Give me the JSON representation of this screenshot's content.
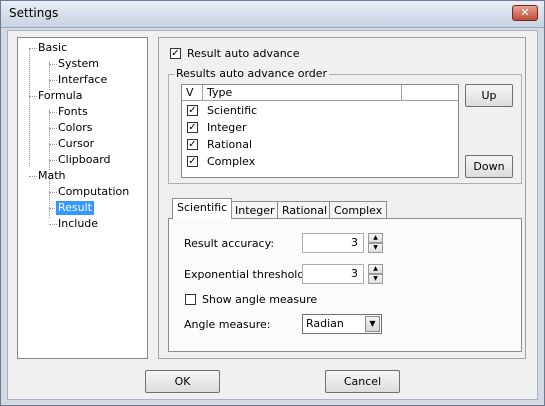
{
  "window": {
    "title": "Settings",
    "close_glyph": "✕"
  },
  "tree": {
    "items": [
      {
        "label": "Basic",
        "level": 0
      },
      {
        "label": "System",
        "level": 1
      },
      {
        "label": "Interface",
        "level": 1
      },
      {
        "label": "Formula",
        "level": 0
      },
      {
        "label": "Fonts",
        "level": 1
      },
      {
        "label": "Colors",
        "level": 1
      },
      {
        "label": "Cursor",
        "level": 1
      },
      {
        "label": "Clipboard",
        "level": 1
      },
      {
        "label": "Math",
        "level": 0
      },
      {
        "label": "Computation",
        "level": 1
      },
      {
        "label": "Result",
        "level": 1,
        "selected": true
      },
      {
        "label": "Include",
        "level": 1
      }
    ]
  },
  "result_auto_advance": {
    "label": "Result auto advance",
    "checked": true,
    "check_glyph": "✓"
  },
  "order_group": {
    "title": "Results auto advance order",
    "columns": [
      "V",
      "Type"
    ],
    "rows": [
      {
        "label": "Scientific",
        "checked": true
      },
      {
        "label": "Integer",
        "checked": true
      },
      {
        "label": "Rational",
        "checked": true
      },
      {
        "label": "Complex",
        "checked": true
      }
    ],
    "up_label": "Up",
    "down_label": "Down"
  },
  "tabs": {
    "items": [
      "Scientific",
      "Integer",
      "Rational",
      "Complex"
    ],
    "active": "Scientific"
  },
  "scientific": {
    "accuracy_label": "Result accuracy:",
    "accuracy_value": "3",
    "exp_label": "Exponential threshold:",
    "exp_value": "3",
    "angle_check_label": "Show angle measure",
    "angle_check_checked": false,
    "angle_label": "Angle measure:",
    "angle_value": "Radian",
    "spin_up_glyph": "▲",
    "spin_down_glyph": "▼",
    "combo_glyph": "▼"
  },
  "footer": {
    "ok_label": "OK",
    "cancel_label": "Cancel"
  },
  "colors": {
    "selection": "#3399ff",
    "close_button": "#c14b36"
  }
}
